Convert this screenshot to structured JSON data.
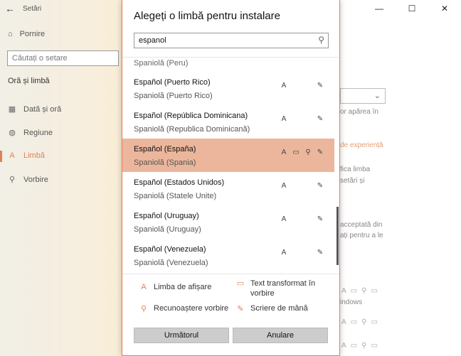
{
  "settings": {
    "app_title": "Setări",
    "home": "Pornire",
    "search_placeholder": "Căutați o setare",
    "section": "Oră și limbă",
    "nav": [
      "Dată și oră",
      "Regiune",
      "Limbă",
      "Vorbire"
    ],
    "bg_texts": {
      "line1": "or apărea în",
      "line2": "de experiență",
      "line3": "fica limba",
      "line4": "setări și",
      "line5": "acceptată din",
      "line6": "ați pentru a le",
      "line7": "indows"
    }
  },
  "dialog": {
    "title": "Alegeți o limbă pentru instalare",
    "search_value": "espanol",
    "partial_item": "Spaniolă (Peru)",
    "languages": [
      {
        "name": "Español (Puerto Rico)",
        "local": "Spaniolă (Puerto Rico)",
        "features": [
          "display",
          "handwriting"
        ],
        "selected": false
      },
      {
        "name": "Español (República Dominicana)",
        "local": "Spaniolă (Republica Dominicană)",
        "features": [
          "display",
          "handwriting"
        ],
        "selected": false
      },
      {
        "name": "Español (España)",
        "local": "Spaniolă (Spania)",
        "features": [
          "display",
          "tts",
          "speech",
          "handwriting"
        ],
        "selected": true
      },
      {
        "name": "Español (Estados Unidos)",
        "local": "Spaniolă (Statele Unite)",
        "features": [
          "display",
          "handwriting"
        ],
        "selected": false
      },
      {
        "name": "Español (Uruguay)",
        "local": "Spaniolă (Uruguay)",
        "features": [
          "display",
          "handwriting"
        ],
        "selected": false
      },
      {
        "name": "Español (Venezuela)",
        "local": "Spaniolă (Venezuela)",
        "features": [
          "display",
          "handwriting"
        ],
        "selected": false
      }
    ],
    "legend": {
      "display": "Limba de afișare",
      "tts_line1": "Text transformat în",
      "tts_line2": "vorbire",
      "speech": "Recunoaștere vorbire",
      "handwriting": "Scriere de mână"
    },
    "next_button": "Următorul",
    "cancel_button": "Anulare"
  },
  "colors": {
    "accent": "#e0805a",
    "selected_row": "#ebb69c"
  }
}
